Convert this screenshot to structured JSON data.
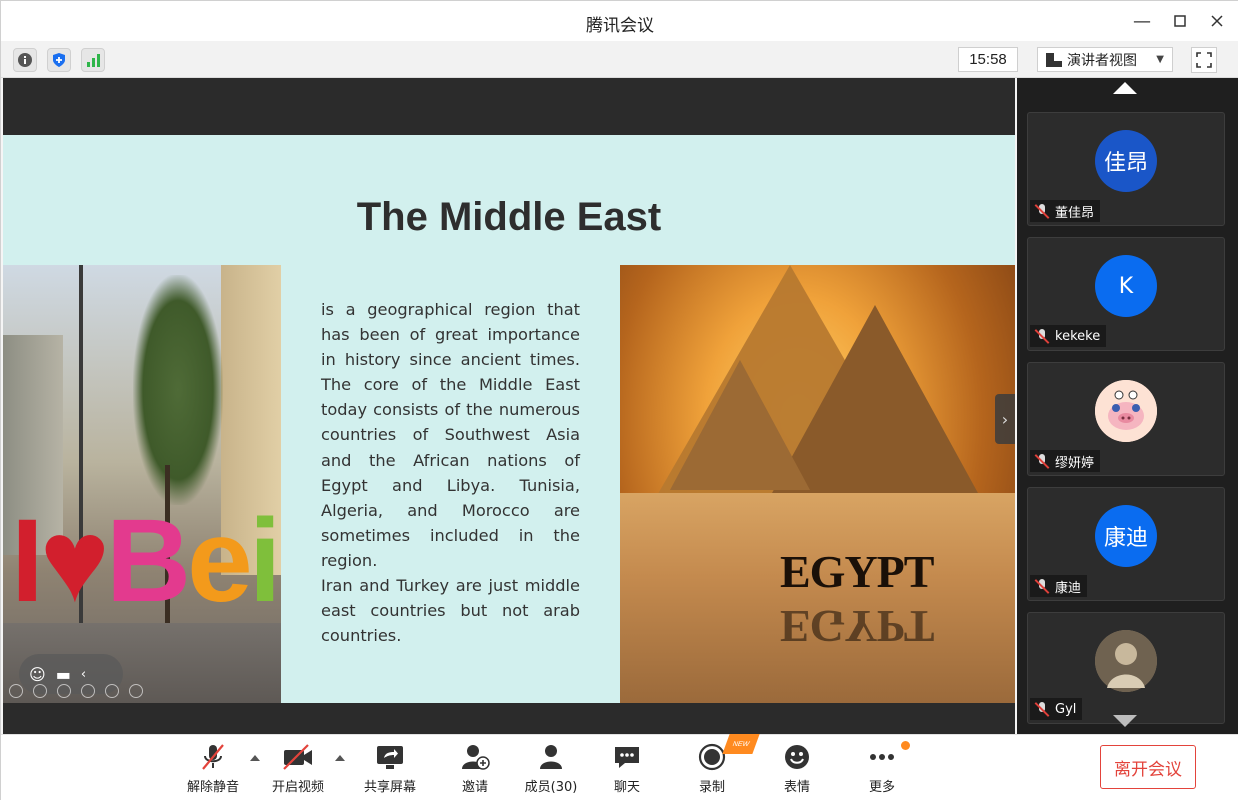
{
  "window": {
    "title": "腾讯会议"
  },
  "toolbar": {
    "time": "15:58",
    "view_mode": "演讲者视图"
  },
  "slide": {
    "title": "The Middle East",
    "body": "is a geographical region that has been of great importance in history since ancient times. The core of the Middle East today consists of the numerous countries of Southwest Asia and the African nations of Egypt and Libya. Tunisia, Algeria, and Morocco are sometimes included in the region.\n Iran and Turkey are just middle east countries but not arab countries.",
    "left_image_text": "IBeirut",
    "right_image_text": "EGYPT"
  },
  "participants": [
    {
      "name": "董佳昂",
      "avatar_text": "佳昂",
      "avatar_color": "#1a56c8",
      "muted": true
    },
    {
      "name": "kekeke",
      "avatar_text": "K",
      "avatar_color": "#0a6cf0",
      "muted": true
    },
    {
      "name": "缪妍婷",
      "avatar_text": "",
      "avatar_color": "#f8d7c9",
      "muted": true
    },
    {
      "name": "康迪",
      "avatar_text": "康迪",
      "avatar_color": "#0a6cf0",
      "muted": true
    },
    {
      "name": "Gyl",
      "avatar_text": "",
      "avatar_color": "#8a7a66",
      "muted": true
    }
  ],
  "bottombar": {
    "unmute": "解除静音",
    "start_video": "开启视频",
    "share_screen": "共享屏幕",
    "invite": "邀请",
    "members": "成员(30)",
    "chat": "聊天",
    "record": "录制",
    "record_badge": "NEW",
    "reactions": "表情",
    "more": "更多",
    "leave": "离开会议"
  },
  "colors": {
    "accent_red": "#e3433b",
    "badge_orange": "#ff8a1f",
    "slide_bg": "#d2f0ee"
  }
}
